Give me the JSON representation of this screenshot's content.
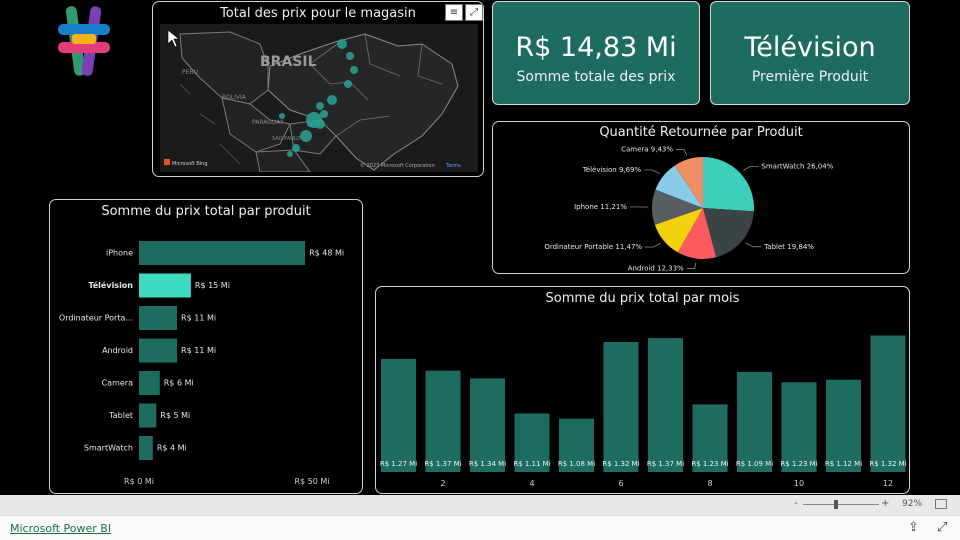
{
  "logo": {
    "icon": "powerbi-cross-logo",
    "colors": [
      "#2f9a6e",
      "#1a7fc8",
      "#e23d7a",
      "#f1b31b",
      "#7a3fb4"
    ]
  },
  "map": {
    "title": "Total des prix pour le magasin",
    "country_label": "BRASIL",
    "labels": [
      "PERU",
      "BOLIVIA",
      "PARAGUAY",
      "SAO PAULO"
    ],
    "attribution": "© 2023 Microsoft Corporation",
    "terms": "Terms",
    "bing": "Microsoft Bing",
    "bubble_color": "#2a9d8f",
    "tools": [
      "filter-icon",
      "expand-icon"
    ]
  },
  "kpis": [
    {
      "value": "R$ 14,83 Mi",
      "label": "Somme totale des prix"
    },
    {
      "value": "Télévision",
      "label": "Première Produit"
    }
  ],
  "product_bar_chart": {
    "title": "Somme du prix total par produit",
    "highlight": "Télévision",
    "colors": {
      "bar": "#1e6b61",
      "highlight": "#3ddbc2"
    },
    "axis_min_label": "R$ 0 Mi",
    "axis_max_label": "R$ 50 Mi"
  },
  "pie_colors": [
    "#3cd0bc",
    "#3c4546",
    "#fd5a5f",
    "#f2d10e",
    "#565e62",
    "#87cce8",
    "#f28e65"
  ],
  "chart_data": [
    {
      "type": "bar",
      "orientation": "horizontal",
      "title": "Somme du prix total par produit",
      "categories": [
        "iPhone",
        "Télévision",
        "Ordinateur Porta...",
        "Android",
        "Camera",
        "Tablet",
        "SmartWatch"
      ],
      "values": [
        48,
        15,
        11,
        11,
        6,
        5,
        4
      ],
      "data_labels": [
        "R$ 48 Mi",
        "R$ 15 Mi",
        "R$ 11 Mi",
        "R$ 11 Mi",
        "R$ 6 Mi",
        "R$ 5 Mi",
        "R$ 4 Mi"
      ],
      "xlim": [
        0,
        50
      ],
      "xticks": [
        "R$ 0 Mi",
        "R$ 50 Mi"
      ]
    },
    {
      "type": "pie",
      "title": "Quantité Retournée par Produit",
      "labels": [
        "SmartWatch",
        "Tablet",
        "Android",
        "Ordinateur Portable",
        "Iphone",
        "Télévision",
        "Camera"
      ],
      "values": [
        26.04,
        19.84,
        12.33,
        11.47,
        11.21,
        9.69,
        9.43
      ],
      "data_labels": [
        "SmartWatch 26,04%",
        "Tablet 19,84%",
        "Android 12,33%",
        "Ordinateur Portable 11,47%",
        "Iphone 11,21%",
        "Télévision 9,69%",
        "Camera 9,43%"
      ]
    },
    {
      "type": "bar",
      "title": "Somme du prix total par mois",
      "x": [
        1,
        2,
        3,
        4,
        5,
        6,
        7,
        8,
        9,
        10,
        11,
        12
      ],
      "values": [
        1.27,
        1.37,
        1.34,
        1.11,
        1.08,
        1.32,
        1.37,
        1.23,
        1.09,
        1.23,
        1.12,
        1.32
      ],
      "bar_heights_relative": [
        0.87,
        0.78,
        0.72,
        0.45,
        0.41,
        1.0,
        1.03,
        0.52,
        0.77,
        0.69,
        0.71,
        1.05
      ],
      "data_labels": [
        "R$ 1.27 Mi",
        "R$ 1.37 Mi",
        "R$ 1.34 Mi",
        "R$ 1.11 Mi",
        "R$ 1.08 Mi",
        "R$ 1.32 Mi",
        "R$ 1.37 Mi",
        "R$ 1.23 Mi",
        "R$ 1.09 Mi",
        "R$ 1.23 Mi",
        "R$ 1.12 Mi",
        "R$ 1.32 Mi"
      ],
      "xticks": [
        "2",
        "4",
        "6",
        "8",
        "10",
        "12"
      ]
    }
  ],
  "status_bar": {
    "zoom_minus": "-",
    "zoom_plus": "+",
    "zoom_level": "92%"
  },
  "footer": {
    "link": "Microsoft Power BI",
    "share_icon": "share-icon",
    "fullscreen_icon": "fullscreen-icon"
  }
}
